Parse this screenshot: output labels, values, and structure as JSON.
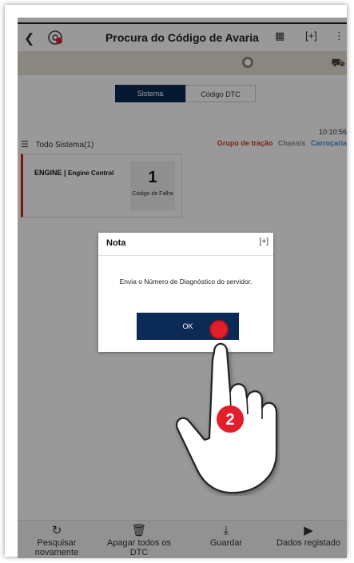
{
  "header": {
    "title": "Procura do Código de Avaria",
    "back_icon": "chevron-left-icon",
    "logo_icon": "diagnostic-logo-icon",
    "action_icons": [
      "dtc-icon",
      "expand-icon",
      "more-icon"
    ]
  },
  "tabs": [
    {
      "label": "Sistema",
      "active": true
    },
    {
      "label": "Código DTC",
      "active": false
    }
  ],
  "time": "10:10:56",
  "system_list": {
    "label": "Todo Sistema(1)"
  },
  "categories": [
    {
      "label": "Grupo de tração",
      "color": "#d03a2a"
    },
    {
      "label": "Chassis",
      "color": "#8f8f8f"
    },
    {
      "label": "Carroçaria",
      "color": "#4a8fd0"
    }
  ],
  "card": {
    "name": "ENGINE",
    "sub": "Engine Control",
    "count": "1",
    "count_label": "Código de Falha"
  },
  "dialog": {
    "title": "Nota",
    "message": "Envia o Número de Diagnóstico do servidor.",
    "ok": "OK"
  },
  "step_number": "2",
  "bottom": [
    {
      "label": "Pesquisar novamente",
      "icon": "refresh-icon"
    },
    {
      "label": "Apagar todos os DTC",
      "icon": "trash-icon"
    },
    {
      "label": "Guardar",
      "icon": "download-icon"
    },
    {
      "label": "Dados registado",
      "icon": "play-icon"
    }
  ],
  "colors": {
    "accent": "#0b2a55",
    "fault": "#d32020",
    "tap": "#e31e2b"
  }
}
